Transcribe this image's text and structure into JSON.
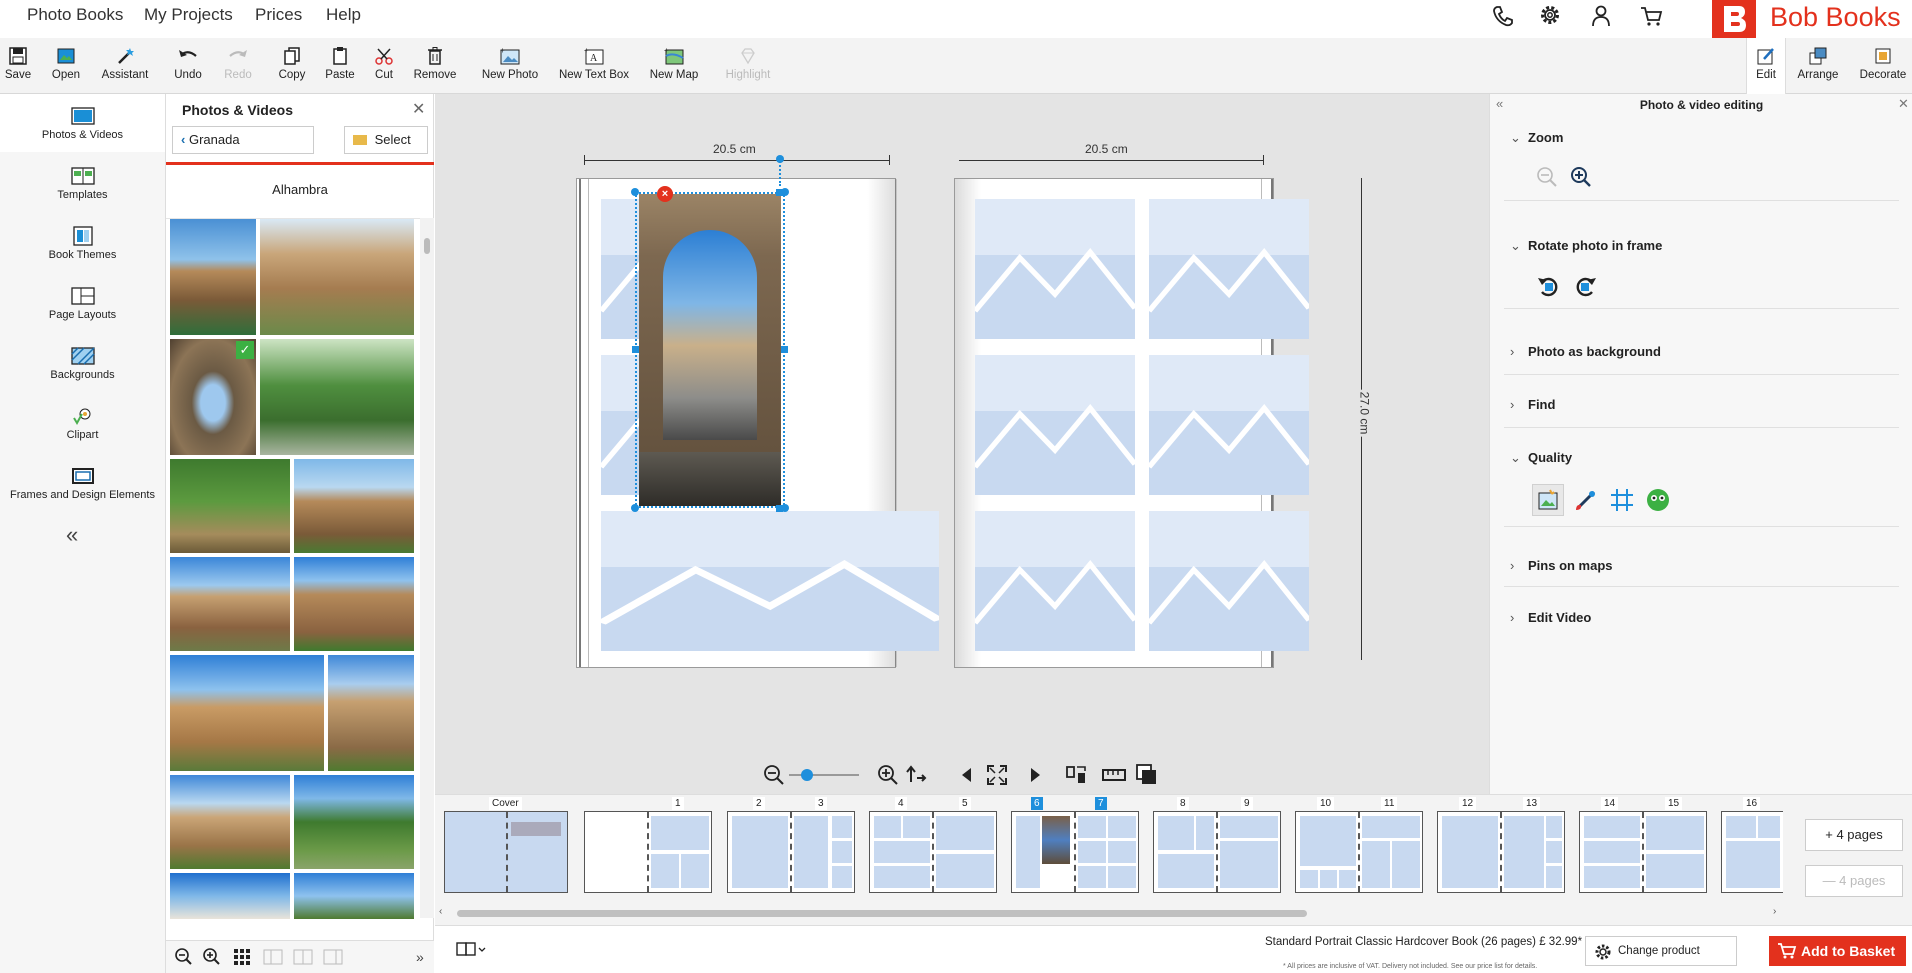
{
  "nav": {
    "links": [
      "Photo Books",
      "My Projects",
      "Prices",
      "Help"
    ],
    "icons": [
      "phone-icon",
      "gear-icon",
      "user-icon",
      "cart-icon"
    ],
    "brand": "Bob Books"
  },
  "toolbar": {
    "save": "Save",
    "open": "Open",
    "assistant": "Assistant",
    "undo": "Undo",
    "redo": "Redo",
    "copy": "Copy",
    "paste": "Paste",
    "cut": "Cut",
    "remove": "Remove",
    "new_photo": "New Photo",
    "new_text_box": "New Text Box",
    "new_map": "New Map",
    "highlight": "Highlight",
    "edit": "Edit",
    "arrange": "Arrange",
    "decorate": "Decorate"
  },
  "sidebar": {
    "items": [
      {
        "label": "Photos & Videos",
        "icon": "photo-icon"
      },
      {
        "label": "Templates",
        "icon": "book-icon"
      },
      {
        "label": "Book Themes",
        "icon": "themes-icon"
      },
      {
        "label": "Page Layouts",
        "icon": "layout-icon"
      },
      {
        "label": "Backgrounds",
        "icon": "background-icon"
      },
      {
        "label": "Clipart",
        "icon": "clipart-icon"
      },
      {
        "label": "Frames and Design Elements",
        "icon": "frame-icon"
      }
    ],
    "collapse": "«"
  },
  "photos_panel": {
    "title": "Photos & Videos",
    "close": "✕",
    "back_label": "Granada",
    "select_label": "Select",
    "album": "Alhambra"
  },
  "canvas": {
    "left_width": "20.5 cm",
    "right_width": "20.5 cm",
    "height": "27.0 cm"
  },
  "right_panel": {
    "title": "Photo & video editing",
    "sections": {
      "zoom": "Zoom",
      "rotate": "Rotate photo in frame",
      "background": "Photo as background",
      "find": "Find",
      "quality": "Quality",
      "pins": "Pins on maps",
      "video": "Edit Video"
    }
  },
  "filmstrip": {
    "cover": "Cover",
    "pages": [
      "1",
      "2",
      "3",
      "4",
      "5",
      "6",
      "7",
      "8",
      "9",
      "10",
      "11",
      "12",
      "13",
      "14",
      "15",
      "16"
    ],
    "selected": [
      "6",
      "7"
    ]
  },
  "add_pages": {
    "add": "+ 4 pages",
    "remove": "— 4 pages"
  },
  "bottom": {
    "product": "Standard Portrait Classic Hardcover Book (26 pages) £ 32.99*",
    "vat": "* All prices are inclusive of VAT. Delivery not included. See our price list for details.",
    "change_details": "Change product details",
    "add_to_basket": "Add to Basket"
  },
  "colors": {
    "brand": "#e3311d",
    "selection": "#1e8fdc",
    "placeholder_bg": "#c4d6ef"
  }
}
